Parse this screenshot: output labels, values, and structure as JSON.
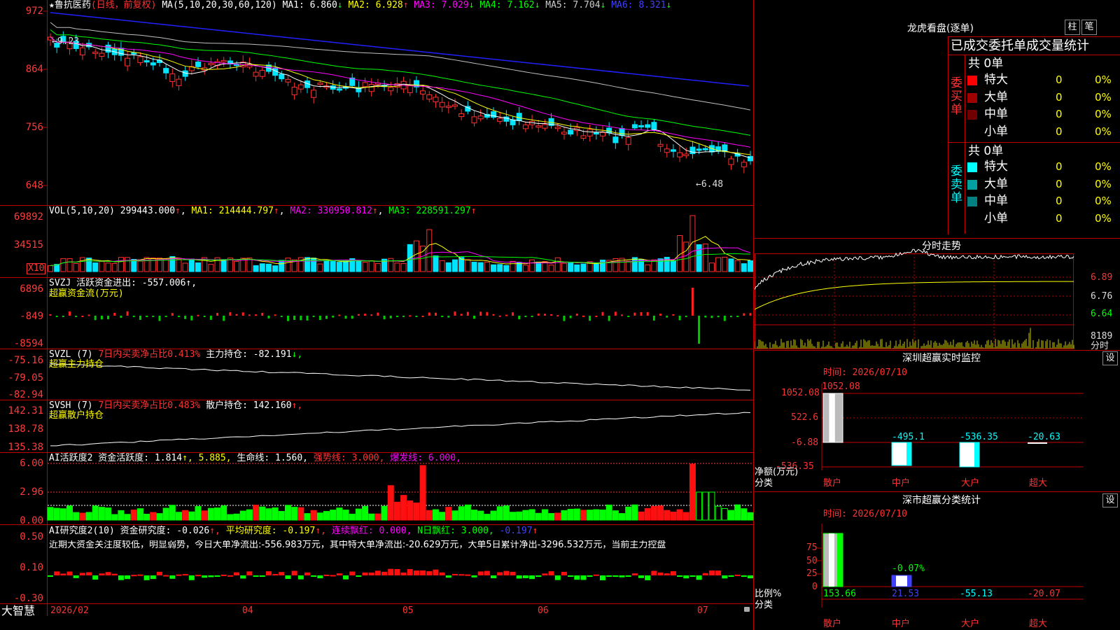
{
  "stock": {
    "name": "★鲁抗医药",
    "mode": "(日线，前复权)"
  },
  "main_panel": {
    "ma_prefix": "MA(5,10,20,30,60,120)",
    "ma": [
      {
        "label": "MA1: 6.860",
        "arrow": "↓",
        "color": "#ffffff"
      },
      {
        "label": "MA2: 6.928",
        "arrow": "↑",
        "color": "#ffff00"
      },
      {
        "label": "MA3: 7.029",
        "arrow": "↓",
        "color": "#ff00ff"
      },
      {
        "label": "MA4: 7.162",
        "arrow": "↓",
        "color": "#00ff00"
      },
      {
        "label": "MA5: 7.704",
        "arrow": "↓",
        "color": "#c0c0c0"
      },
      {
        "label": "MA6: 8.321",
        "arrow": "↓",
        "color": "#2020ff"
      }
    ],
    "y_ticks": [
      "972",
      "864",
      "756",
      "648"
    ],
    "hi_note": "←9.23",
    "lo_note": "←6.48"
  },
  "vol_panel": {
    "prefix": "VOL(5,10,20)",
    "items": [
      {
        "label": "299443.000",
        "arrow": "↑",
        "color": "#ffffff"
      },
      {
        "label": "MA1: 214444.797",
        "arrow": "↑",
        "color": "#ffff00"
      },
      {
        "label": "MA2: 330950.812",
        "arrow": "↑",
        "color": "#ff00ff"
      },
      {
        "label": "MA3: 228591.297",
        "arrow": "↑",
        "color": "#00ff00"
      }
    ],
    "y_ticks": [
      "69892",
      "34515"
    ],
    "unit": "X10"
  },
  "svzj_panel": {
    "line1": "SVZJ  活跃资金进出: -557.006↑,",
    "line2": "超赢资金流(万元)",
    "y_ticks": [
      "6896",
      "-849",
      "-8594"
    ]
  },
  "svzl_panel": {
    "prefix": "SVZL (7)",
    "red": "7日内买卖净占比0.413%",
    "white": "主力持仓: -82.191",
    "arrow": "↓,",
    "line2": "超赢主力持仓",
    "y_ticks": [
      "-75.16",
      "-79.05",
      "-82.94"
    ]
  },
  "svsh_panel": {
    "prefix": "SVSH (7)",
    "red": "7日内买卖净占比0.483%",
    "white": "散户持仓: 142.160",
    "arrow": "↑,",
    "line2": "超赢散户持仓",
    "y_ticks": [
      "142.31",
      "138.78",
      "135.38"
    ]
  },
  "ai_activity": {
    "text": "AI活跃度2 资金活跃度: 1.814",
    "v2": "↑, 5.885,",
    "v3": "生命线: 1.560,",
    "v4": "强势线: 3.000,",
    "v5": "爆发线: 6.000,",
    "y_ticks": [
      "6.00",
      "2.96",
      "0.00"
    ]
  },
  "ai_research": {
    "t1": "AI研究度2(10) 资金研究度: -0.026",
    "t1a": "↑,",
    "t2": "平均研究度: -0.197",
    "t2a": "↑,",
    "t3": "连续飘红: 0.000,",
    "t4": "N日飘红: 3.000,",
    "t5": "-0.197",
    "t5a": "↑",
    "comment": "近期大资金关注度较低，明显弱势，今日大单净流出:-556.983万元，其中特大单净流出:-20.629万元，大单5日累计净出-3296.532万元，当前主力控盘",
    "y_ticks": [
      "0.50",
      "0.10",
      "-0.30"
    ]
  },
  "x_axis": {
    "labels": [
      "2026/02",
      "04",
      "05",
      "06",
      "07"
    ],
    "brand": "大智慧"
  },
  "lhb": {
    "title": "龙虎看盘(逐单)",
    "tab1": "柱",
    "tab2": "笔",
    "header": "已成交委托单成交量统计",
    "buy_total": "共 0单",
    "sell_total": "共 0单",
    "buy_side": "委买单",
    "sell_side": "委卖单",
    "buy_rows": [
      {
        "label": "特大",
        "val": "0",
        "pct": "0%",
        "color": "#ff0000"
      },
      {
        "label": "大单",
        "val": "0",
        "pct": "0%",
        "color": "#a00000"
      },
      {
        "label": "中单",
        "val": "0",
        "pct": "0%",
        "color": "#700000"
      },
      {
        "label": "小单",
        "val": "0",
        "pct": "0%",
        "color": "#000000"
      }
    ],
    "sell_rows": [
      {
        "label": "特大",
        "val": "0",
        "pct": "0%",
        "color": "#00ffff"
      },
      {
        "label": "大单",
        "val": "0",
        "pct": "0%",
        "color": "#00a0a0"
      },
      {
        "label": "中单",
        "val": "0",
        "pct": "0%",
        "color": "#008080"
      },
      {
        "label": "小单",
        "val": "0",
        "pct": "0%",
        "color": "#000000"
      }
    ]
  },
  "intraday": {
    "title": "分时走势",
    "y_ticks": [
      "6.89",
      "6.76",
      "6.64"
    ],
    "vol_tick": "8189",
    "vol_unit": "分时"
  },
  "sz_monitor": {
    "title": "深圳超赢实时监控",
    "btn": "设",
    "date": "时间: 2026/07/10",
    "y_ticks": [
      "1052.08",
      "522.6",
      "-6.88",
      "-536.35"
    ],
    "ylabel": "净额(万元)",
    "xlabel": "分类",
    "cats": [
      "散户",
      "中户",
      "大户",
      "超大"
    ],
    "values": [
      "1052.08",
      "-495.1",
      "-536.35",
      "-20.63"
    ]
  },
  "sz_class": {
    "title": "深市超赢分类统计",
    "btn": "设",
    "date": "时间: 2026/07/10",
    "y_ticks": [
      "75",
      "50",
      "25",
      "0"
    ],
    "ylabel": "比例%",
    "xlabel": "分类",
    "bar_label": "-0.07%",
    "cats": [
      "散户",
      "中户",
      "大户",
      "超大"
    ],
    "values": [
      "153.66",
      "21.53",
      "-55.13",
      "-20.07"
    ]
  }
}
